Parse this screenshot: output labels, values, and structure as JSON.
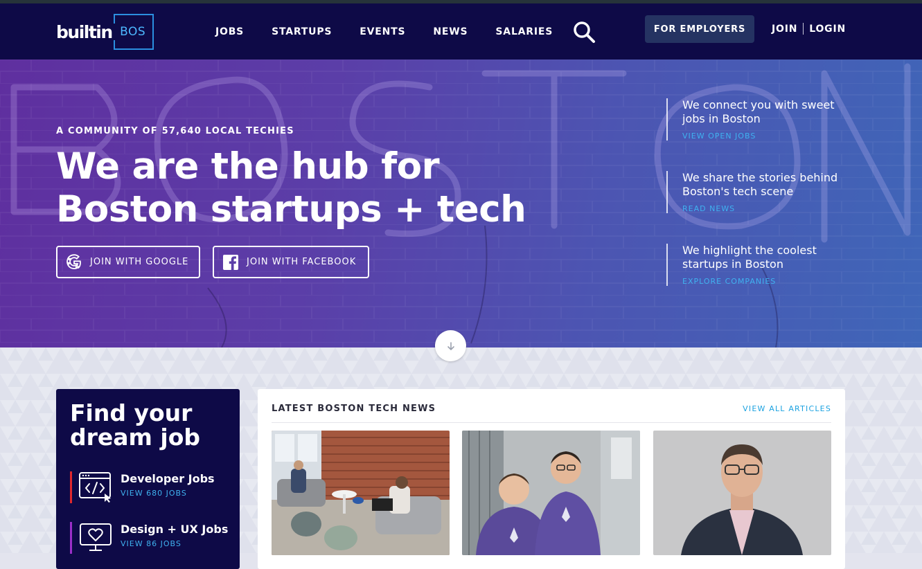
{
  "nav": {
    "logo_word": "builtin",
    "logo_city": "BOS",
    "links": [
      "JOBS",
      "STARTUPS",
      "EVENTS",
      "NEWS",
      "SALARIES"
    ],
    "employers_label": "FOR EMPLOYERS",
    "join_label": "JOIN",
    "login_label": "LOGIN"
  },
  "hero": {
    "kicker": "A COMMUNITY OF 57,640 LOCAL TECHIES",
    "title_line1": "We are the hub for",
    "title_line2": "Boston startups + tech",
    "google_label": "JOIN WITH GOOGLE",
    "facebook_label": "JOIN WITH FACEBOOK",
    "items": [
      {
        "text": "We connect you with sweet jobs in Boston",
        "link": "VIEW OPEN JOBS"
      },
      {
        "text": "We share the stories behind Boston's tech scene",
        "link": "READ NEWS"
      },
      {
        "text": "We highlight the coolest startups in Boston",
        "link": "EXPLORE COMPANIES"
      }
    ]
  },
  "dream": {
    "title_line1": "Find your",
    "title_line2": "dream job",
    "categories": [
      {
        "name": "Developer Jobs",
        "count": "VIEW 680 JOBS",
        "color": "#e0282e",
        "icon": "code-window-icon"
      },
      {
        "name": "Design + UX Jobs",
        "count": "VIEW 86 JOBS",
        "color": "#9b2fc9",
        "icon": "heart-monitor-icon"
      }
    ]
  },
  "news": {
    "heading": "LATEST BOSTON TECH NEWS",
    "view_all": "VIEW ALL ARTICLES"
  },
  "colors": {
    "navy": "#0e0a47",
    "accent_blue": "#3fb2f0",
    "employer_button": "#253362"
  }
}
